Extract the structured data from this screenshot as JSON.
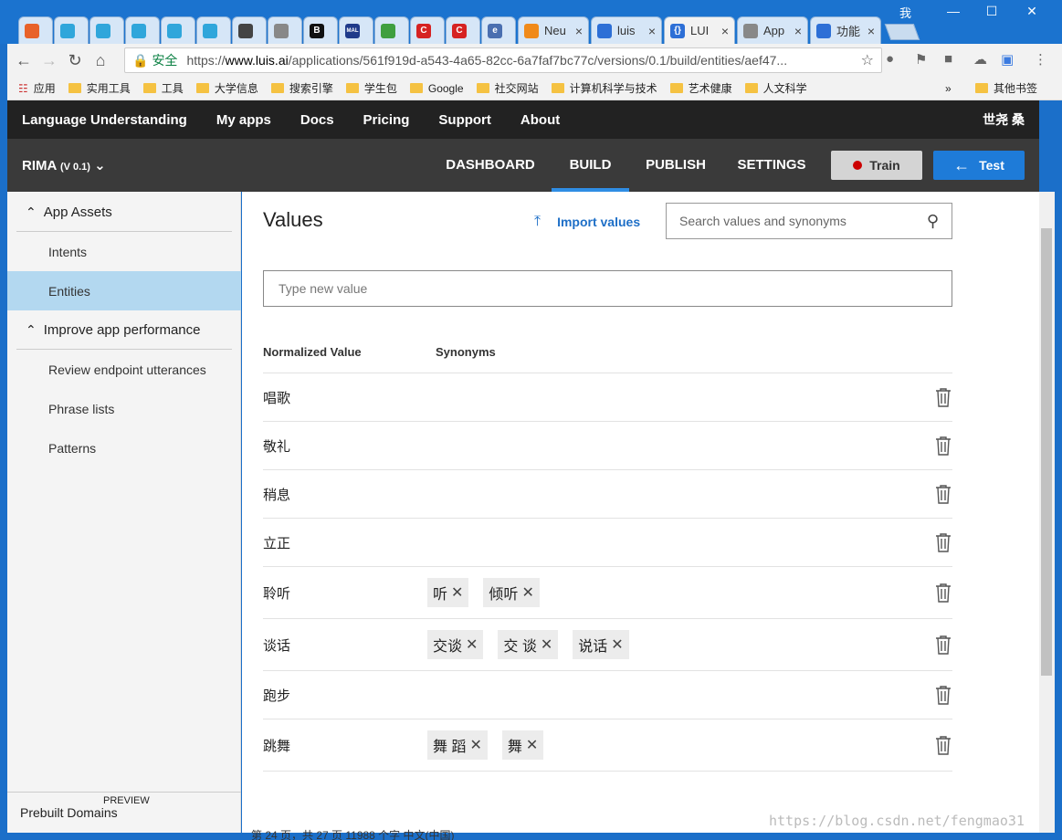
{
  "browser": {
    "tabs": [
      {
        "label": "",
        "icon_color": "#e8622a",
        "icon_text": ""
      },
      {
        "label": "",
        "icon_color": "#2fa6db",
        "icon_text": ""
      },
      {
        "label": "",
        "icon_color": "#2fa6db",
        "icon_text": ""
      },
      {
        "label": "",
        "icon_color": "#2fa6db",
        "icon_text": ""
      },
      {
        "label": "",
        "icon_color": "#2fa6db",
        "icon_text": ""
      },
      {
        "label": "",
        "icon_color": "#2fa6db",
        "icon_text": ""
      },
      {
        "label": "",
        "icon_color": "#444444",
        "icon_text": ""
      },
      {
        "label": "",
        "icon_color": "#888888",
        "icon_text": ""
      },
      {
        "label": "",
        "icon_color": "#111111",
        "icon_text": "B"
      },
      {
        "label": "",
        "icon_color": "#1f3a8a",
        "icon_text": "MAL"
      },
      {
        "label": "",
        "icon_color": "#3f9f3f",
        "icon_text": ""
      },
      {
        "label": "",
        "icon_color": "#d62222",
        "icon_text": "C"
      },
      {
        "label": "",
        "icon_color": "#d62222",
        "icon_text": "C"
      },
      {
        "label": "",
        "icon_color": "#4a6fb0",
        "icon_text": "e"
      },
      {
        "label": "Neu",
        "icon_color": "#f08a1a",
        "icon_text": ""
      },
      {
        "label": "luis",
        "icon_color": "#2d6fd6",
        "icon_text": ""
      },
      {
        "label": "LUI",
        "icon_color": "#2d6fd6",
        "icon_text": "{}"
      },
      {
        "label": "App",
        "icon_color": "#888888",
        "icon_text": ""
      },
      {
        "label": "功能",
        "icon_color": "#2d6fd6",
        "icon_text": ""
      }
    ],
    "ime_indicator": "我",
    "secure_label": "安全",
    "url_https": "https://",
    "url_domain": "www.luis.ai",
    "url_path": "/applications/561f919d-a543-4a65-82cc-6a7faf7bc77c/versions/0.1/build/entities/aef47...",
    "bookmarks": [
      "应用",
      "实用工具",
      "工具",
      "大学信息",
      "搜索引擎",
      "学生包",
      "Google",
      "社交网站",
      "计算机科学与技术",
      "艺术健康",
      "人文科学"
    ],
    "bookmarks_more": "»",
    "other_bookmarks": "其他书签"
  },
  "app": {
    "nav": [
      "Language Understanding",
      "My apps",
      "Docs",
      "Pricing",
      "Support",
      "About"
    ],
    "user_name": "世尧 桑",
    "app_name": "RIMA",
    "app_version": "(V 0.1)",
    "sections": [
      "DASHBOARD",
      "BUILD",
      "PUBLISH",
      "SETTINGS"
    ],
    "train_label": "Train",
    "test_label": "Test"
  },
  "sidebar": {
    "group1": "App Assets",
    "items1": [
      "Intents",
      "Entities"
    ],
    "group2": "Improve app performance",
    "items2": [
      "Review endpoint utterances",
      "Phrase lists",
      "Patterns"
    ],
    "prebuilt_preview": "PREVIEW",
    "prebuilt_label": "Prebuilt Domains"
  },
  "main": {
    "title": "Values",
    "import_label": "Import values",
    "search_placeholder": "Search values and synonyms",
    "new_value_placeholder": "Type new value",
    "col_normalized": "Normalized Value",
    "col_synonyms": "Synonyms",
    "rows": [
      {
        "value": "唱歌",
        "synonyms": []
      },
      {
        "value": "敬礼",
        "synonyms": []
      },
      {
        "value": "稍息",
        "synonyms": []
      },
      {
        "value": "立正",
        "synonyms": []
      },
      {
        "value": "聆听",
        "synonyms": [
          "听",
          "倾听"
        ]
      },
      {
        "value": "谈话",
        "synonyms": [
          "交谈",
          "交 谈",
          "说话"
        ]
      },
      {
        "value": "跑步",
        "synonyms": []
      },
      {
        "value": "跳舞",
        "synonyms": [
          "舞 蹈",
          "舞"
        ]
      }
    ]
  },
  "footer": {
    "status_text": "第 24 页，共 27 页    11988 个字    中文(中国)",
    "watermark": "https://blog.csdn.net/fengmao31"
  }
}
